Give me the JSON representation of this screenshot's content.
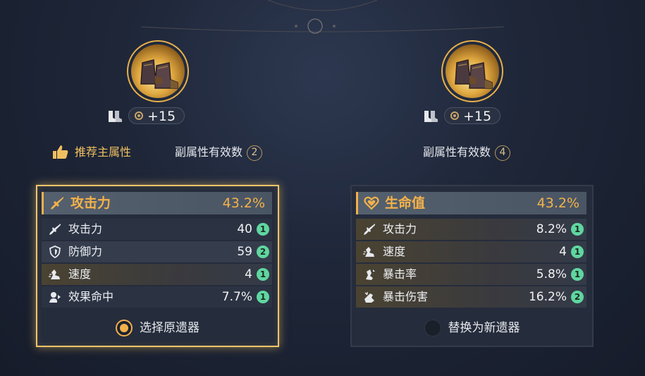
{
  "left": {
    "level": "+15",
    "recommend_label": "推荐主属性",
    "effective_label": "副属性有效数",
    "effective_count": "2",
    "main_stat": {
      "icon": "sword-icon",
      "label": "攻击力",
      "value": "43.2%"
    },
    "sub_stats": [
      {
        "icon": "sword-icon",
        "label": "攻击力",
        "value": "40",
        "rolls": "1"
      },
      {
        "icon": "shield-icon",
        "label": "防御力",
        "value": "59",
        "rolls": "2"
      },
      {
        "icon": "speed-icon",
        "label": "速度",
        "value": "4",
        "rolls": "1"
      },
      {
        "icon": "effect-hit-icon",
        "label": "效果命中",
        "value": "7.7%",
        "rolls": "1"
      }
    ],
    "choice_label": "选择原遗器",
    "selected": true
  },
  "right": {
    "level": "+15",
    "effective_label": "副属性有效数",
    "effective_count": "4",
    "main_stat": {
      "icon": "heart-icon",
      "label": "生命值",
      "value": "43.2%"
    },
    "sub_stats": [
      {
        "icon": "sword-icon",
        "label": "攻击力",
        "value": "8.2%",
        "rolls": "1"
      },
      {
        "icon": "speed-icon",
        "label": "速度",
        "value": "4",
        "rolls": "1"
      },
      {
        "icon": "crit-rate-icon",
        "label": "暴击率",
        "value": "5.8%",
        "rolls": "1"
      },
      {
        "icon": "crit-dmg-icon",
        "label": "暴击伤害",
        "value": "16.2%",
        "rolls": "2"
      }
    ],
    "choice_label": "替换为新遗器",
    "selected": false
  },
  "colors": {
    "accent": "#f4b24a",
    "roll_badge": "#5fd6a0",
    "selected_border": "#f2c56a"
  }
}
